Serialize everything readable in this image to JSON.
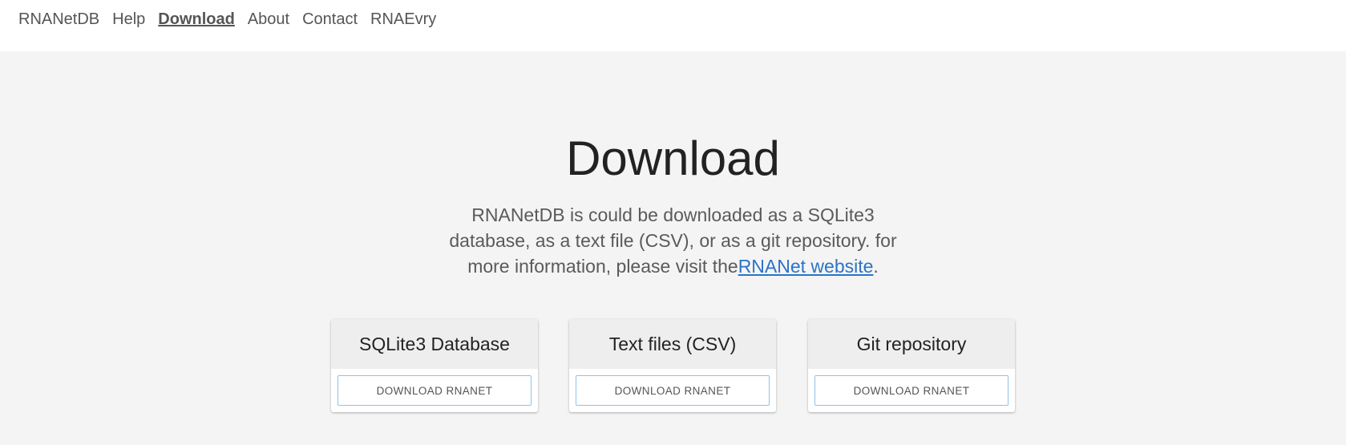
{
  "nav": {
    "items": [
      {
        "label": "RNANetDB",
        "active": false
      },
      {
        "label": "Help",
        "active": false
      },
      {
        "label": "Download",
        "active": true
      },
      {
        "label": "About",
        "active": false
      },
      {
        "label": "Contact",
        "active": false
      },
      {
        "label": "RNAEvry",
        "active": false
      }
    ]
  },
  "main": {
    "title": "Download",
    "intro_text": "RNANetDB is could be downloaded as a SQLite3 database, as a text file (CSV), or as a git repository. for more information, please visit the",
    "intro_link": "RNANet website",
    "intro_end": ".",
    "cards": [
      {
        "title": "SQLite3 Database",
        "button": "DOWNLOAD RNANET"
      },
      {
        "title": "Text files (CSV)",
        "button": "DOWNLOAD RNANET"
      },
      {
        "title": "Git repository",
        "button": "DOWNLOAD RNANET"
      }
    ]
  },
  "colors": {
    "nav_background": "#ffffff",
    "page_background": "#f4f4f4",
    "link": "#2b73c7",
    "button_border": "#8ec3e8"
  }
}
